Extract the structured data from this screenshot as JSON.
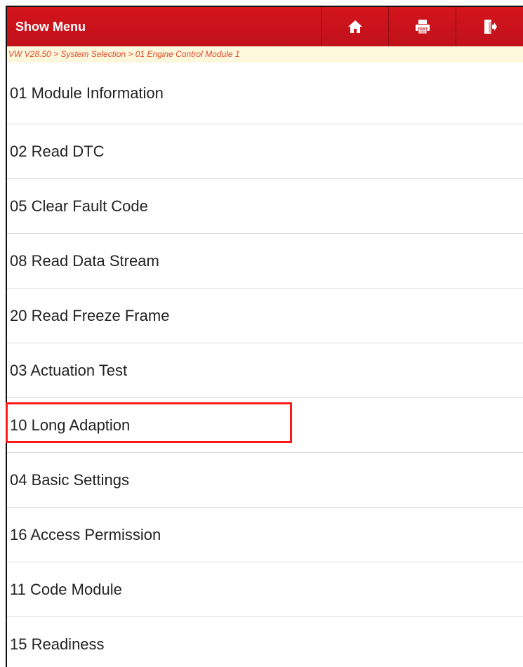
{
  "header": {
    "title": "Show Menu",
    "buttons": [
      {
        "icon": "home-icon"
      },
      {
        "icon": "print-icon"
      },
      {
        "icon": "exit-icon"
      }
    ],
    "background_color": "#c8131b"
  },
  "breadcrumb": {
    "text": "VW V28.50 > System Selection > 01 Engine Control Module 1",
    "color": "#e04a2a",
    "background_color": "#fdf7dc"
  },
  "menu": {
    "items": [
      {
        "label": "01 Module Information"
      },
      {
        "label": "02 Read DTC"
      },
      {
        "label": "05 Clear Fault Code"
      },
      {
        "label": "08 Read Data Stream"
      },
      {
        "label": "20 Read Freeze Frame"
      },
      {
        "label": "03 Actuation Test"
      },
      {
        "label": "10 Long Adaption",
        "highlighted": true
      },
      {
        "label": "04 Basic Settings"
      },
      {
        "label": "16 Access Permission"
      },
      {
        "label": "11 Code Module"
      },
      {
        "label": "15 Readiness"
      }
    ]
  },
  "annotation": {
    "highlight_color": "#ff1a1a",
    "highlighted_item": "10 Long Adaption"
  }
}
